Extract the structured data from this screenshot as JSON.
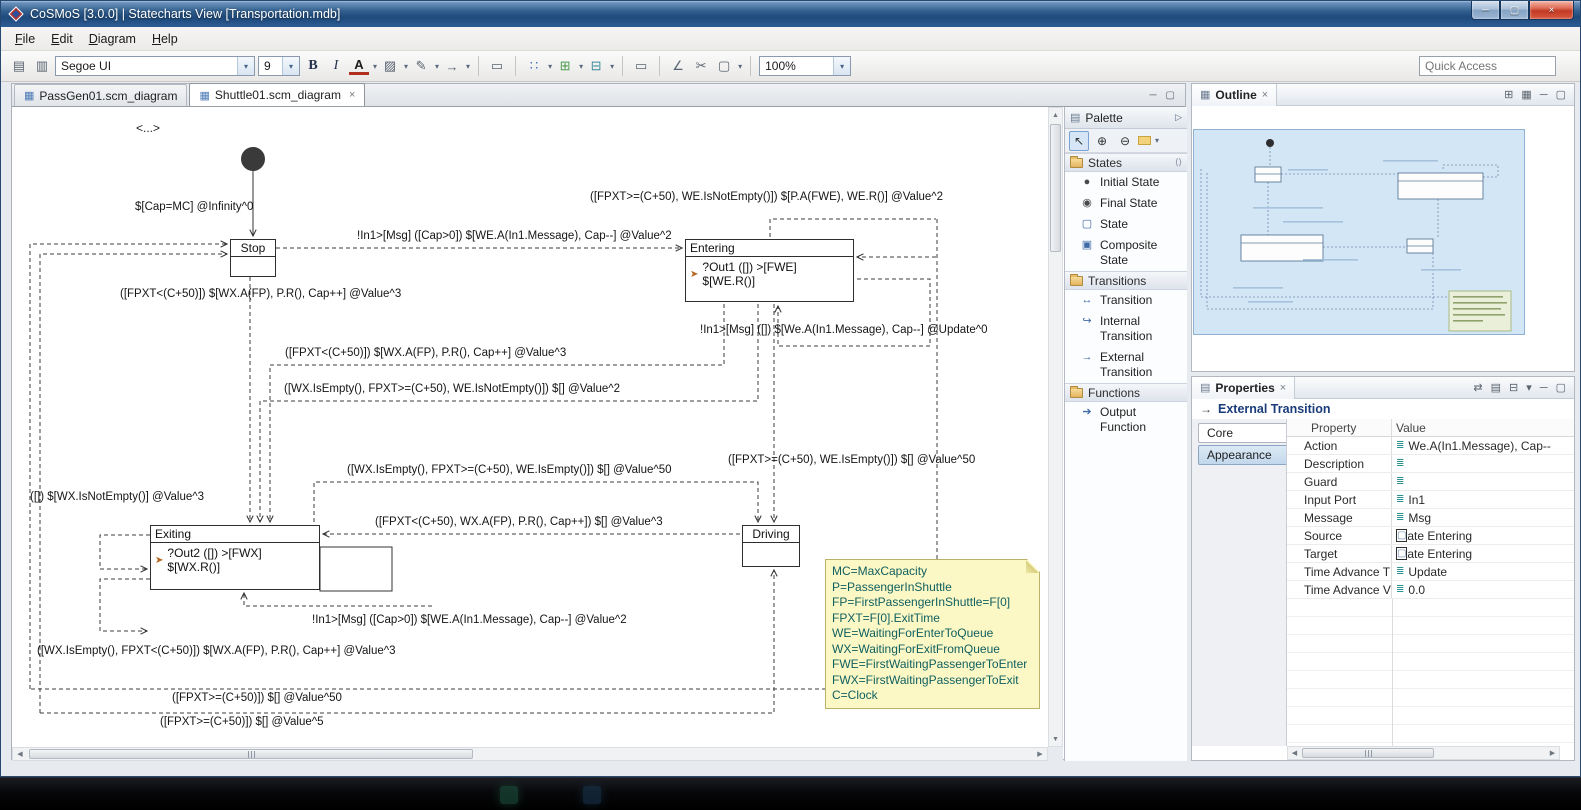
{
  "window": {
    "title": "CoSMoS [3.0.0] | Statecharts View [Transportation.mdb]"
  },
  "menu": {
    "items": [
      "File",
      "Edit",
      "Diagram",
      "Help"
    ]
  },
  "toolbar": {
    "font_name": "Segoe UI",
    "font_size": "9",
    "bold_label": "B",
    "italic_label": "I",
    "font_color_label": "A",
    "zoom_value": "100%",
    "quick_access_placeholder": "Quick Access"
  },
  "tabs": [
    {
      "label": "PassGen01.scm_diagram"
    },
    {
      "label": "Shuttle01.scm_diagram"
    }
  ],
  "canvas": {
    "corner_label": "<...>",
    "states": {
      "stop": {
        "name": "Stop"
      },
      "entering": {
        "name": "Entering",
        "action": "?Out1 ([]) >[FWE] $[WE.R()]"
      },
      "exiting": {
        "name": "Exiting",
        "action": "?Out2 ([]) >[FWX] $[WX.R()]"
      },
      "driving": {
        "name": "Driving"
      }
    },
    "labels": [
      "$[Cap=MC] @Infinity^0",
      "!In1>[Msg] ([Cap>0]) $[WE.A(In1.Message), Cap--] @Value^2",
      "([FPXT>=(C+50), WE.IsNotEmpty()]) $[P.A(FWE), WE.R()] @Value^2",
      "([FPXT<(C+50)]) $[WX.A(FP), P.R(), Cap++] @Value^3",
      "!In1>[Msg] ([]) $[We.A(In1.Message), Cap--] @Update^0",
      "([FPXT<(C+50)]) $[WX.A(FP), P.R(), Cap++] @Value^3",
      "([WX.IsEmpty(), FPXT>=(C+50), WE.IsNotEmpty()]) $[] @Value^2",
      "([WX.IsEmpty(), FPXT>=(C+50), WE.IsEmpty()]) $[] @Value^50",
      "([FPXT>=(C+50), WE.IsEmpty()]) $[] @Value^50",
      "([]) $[WX.IsNotEmpty()] @Value^3",
      "([FPXT<(C+50), WX.A(FP), P.R(), Cap++]) $[] @Value^3",
      "!In1>[Msg] ([Cap>0]) $[WE.A(In1.Message), Cap--] @Value^2",
      "([WX.IsEmpty(), FPXT<(C+50)]) $[WX.A(FP), P.R(), Cap++] @Value^3",
      "([FPXT>=(C+50)]) $[] @Value^50",
      "([FPXT>=(C+50)]) $[] @Value^5"
    ],
    "note": {
      "lines": [
        "MC=MaxCapacity",
        "P=PassengerInShuttle",
        "FP=FirstPassengerInShuttle=F[0]",
        "FPXT=F[0].ExitTime",
        "WE=WaitingForEnterToQueue",
        "WX=WaitingForExitFromQueue",
        "FWE=FirstWaitingPassengerToEnter",
        "FWX=FirstWaitingPassengerToExit",
        "C=Clock"
      ]
    }
  },
  "palette": {
    "title": "Palette",
    "sections": [
      {
        "label": "States",
        "items": [
          {
            "label": "Initial State"
          },
          {
            "label": "Final State"
          },
          {
            "label": "State"
          },
          {
            "label": "Composite State"
          }
        ]
      },
      {
        "label": "Transitions",
        "items": [
          {
            "label": "Transition"
          },
          {
            "label": "Internal Transition"
          },
          {
            "label": "External Transition"
          }
        ]
      },
      {
        "label": "Functions",
        "items": [
          {
            "label": "Output Function"
          }
        ]
      }
    ]
  },
  "outline": {
    "title": "Outline"
  },
  "properties": {
    "title": "Properties",
    "selection_title": "External Transition",
    "tabs": [
      "Core",
      "Appearance"
    ],
    "columns": [
      "Property",
      "Value"
    ],
    "rows": [
      {
        "property": "Action",
        "value": "We.A(In1.Message), Cap--"
      },
      {
        "property": "Description",
        "value": ""
      },
      {
        "property": "Guard",
        "value": ""
      },
      {
        "property": "Input Port",
        "value": "In1"
      },
      {
        "property": "Message",
        "value": "Msg"
      },
      {
        "property": "Source",
        "value": "State Entering"
      },
      {
        "property": "Target",
        "value": "State Entering"
      },
      {
        "property": "Time Advance T",
        "value": "Update"
      },
      {
        "property": "Time Advance V",
        "value": "0.0"
      }
    ]
  },
  "glyphs": {
    "minimize": "─",
    "maximize": "▢",
    "close": "×",
    "caret": "▾",
    "tab_icon": "▦",
    "view_min": "─",
    "view_max": "▢",
    "save": "▤",
    "print": "▥",
    "bucket": "▨",
    "pencil": "✎",
    "arrow_right": "→",
    "select_dots": "∷",
    "org_green": "⊞",
    "org_teal": "⊟",
    "shape_box": "▭",
    "wave": "∠",
    "cut": "✂",
    "frame_box": "▢",
    "cursor": "↖",
    "zoom_in": "⊕",
    "zoom_out": "⊖",
    "palette_arrow": "▷",
    "section_extra": "⟨⟩",
    "initial_state": "●",
    "final_state": "◉",
    "state": "▢",
    "composite": "▣",
    "transition": "↔",
    "internal_transition": "↪",
    "external_transition": "→",
    "output_function": "➔",
    "up": "▲",
    "down": "▼",
    "left": "◀",
    "right": "▶",
    "prop_list": "≣",
    "prop_state": "▢",
    "state_action": "➤",
    "outline_tree": "⊞",
    "outline_view": "▦",
    "sync": "⇄",
    "props_table": "▤",
    "collapse": "⊟"
  }
}
